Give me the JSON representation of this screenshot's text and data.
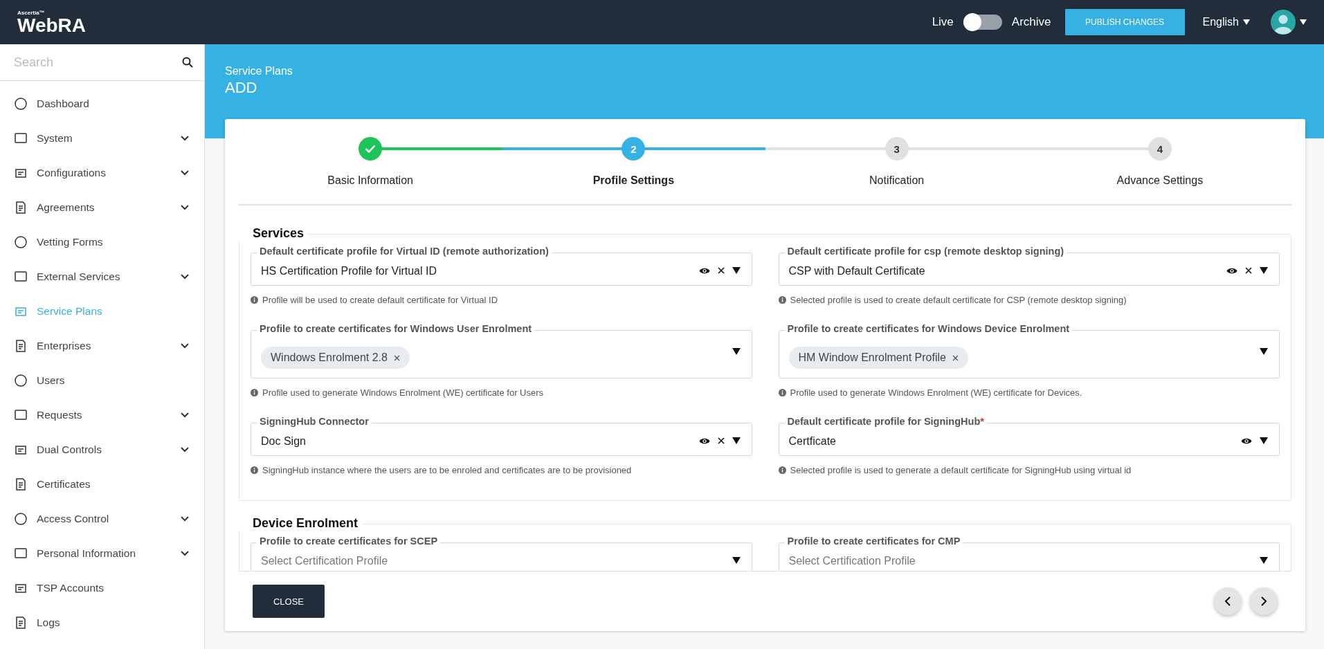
{
  "header": {
    "brand_small": "Ascertia™",
    "brand": "WebRA",
    "toggle": {
      "left_label": "Live",
      "right_label": "Archive",
      "on": false
    },
    "publish_button": "PUBLISH CHANGES",
    "language": "English"
  },
  "sidebar": {
    "search": {
      "placeholder": "Search"
    },
    "items": [
      {
        "label": "Dashboard",
        "expandable": false,
        "selected": false
      },
      {
        "label": "System",
        "expandable": true,
        "selected": false
      },
      {
        "label": "Configurations",
        "expandable": true,
        "selected": false
      },
      {
        "label": "Agreements",
        "expandable": true,
        "selected": false
      },
      {
        "label": "Vetting Forms",
        "expandable": false,
        "selected": false
      },
      {
        "label": "External Services",
        "expandable": true,
        "selected": false
      },
      {
        "label": "Service Plans",
        "expandable": false,
        "selected": true
      },
      {
        "label": "Enterprises",
        "expandable": true,
        "selected": false
      },
      {
        "label": "Users",
        "expandable": false,
        "selected": false
      },
      {
        "label": "Requests",
        "expandable": true,
        "selected": false
      },
      {
        "label": "Dual Controls",
        "expandable": true,
        "selected": false
      },
      {
        "label": "Certificates",
        "expandable": false,
        "selected": false
      },
      {
        "label": "Access Control",
        "expandable": true,
        "selected": false
      },
      {
        "label": "Personal Information",
        "expandable": true,
        "selected": false
      },
      {
        "label": "TSP Accounts",
        "expandable": false,
        "selected": false
      },
      {
        "label": "Logs",
        "expandable": false,
        "selected": false
      }
    ]
  },
  "banner": {
    "breadcrumb": "Service Plans",
    "title": "ADD"
  },
  "stepper": [
    {
      "label": "Basic Information",
      "completed": true,
      "selected": false
    },
    {
      "number": "2",
      "label": "Profile Settings",
      "completed": false,
      "selected": true
    },
    {
      "number": "3",
      "label": "Notification",
      "completed": false,
      "selected": false
    },
    {
      "number": "4",
      "label": "Advance Settings",
      "completed": false,
      "selected": false
    }
  ],
  "sections": [
    {
      "title": "Services",
      "fields": [
        {
          "kind": "select",
          "label": "Default certificate profile for Virtual ID (remote authorization)",
          "value": "HS Certification Profile for Virtual ID",
          "viewable": true,
          "clearable": true,
          "hint": "Profile will be used to create default certificate for Virtual ID"
        },
        {
          "kind": "select",
          "label": "Default certificate profile for csp (remote desktop signing)",
          "value": "CSP with Default Certificate",
          "viewable": true,
          "clearable": true,
          "hint": "Selected profile is used to create default certificate for CSP (remote desktop signing)"
        },
        {
          "kind": "tags",
          "label": "Profile to create certificates for Windows User Enrolment",
          "tags": [
            "Windows Enrolment 2.8"
          ],
          "hint": "Profile used to generate Windows Enrolment (WE) certificate for Users"
        },
        {
          "kind": "tags",
          "label": "Profile to create certificates for Windows Device Enrolment",
          "tags": [
            "HM Window Enrolment Profile"
          ],
          "hint": "Profile used to generate Windows Enrolment (WE) certificate for Devices."
        },
        {
          "kind": "select",
          "label": "SigningHub Connector",
          "value": "Doc Sign",
          "viewable": true,
          "clearable": true,
          "hint": "SigningHub instance where the users are to be enroled and certificates are to be provisioned"
        },
        {
          "kind": "select",
          "label": "Default certificate profile for SigningHub",
          "required_mark": "*",
          "value": "Certficate",
          "viewable": true,
          "clearable": false,
          "hint": "Selected profile is used to generate a default certificate for SigningHub using virtual id"
        }
      ]
    },
    {
      "title": "Device Enrolment",
      "fields": [
        {
          "kind": "select",
          "label": "Profile to create certificates for SCEP",
          "placeholder": "Select Certification Profile",
          "viewable": false,
          "clearable": false
        },
        {
          "kind": "select",
          "label": "Profile to create certificates for CMP",
          "placeholder": "Select Certification Profile",
          "viewable": false,
          "clearable": false
        }
      ]
    }
  ],
  "footer": {
    "close_button": "CLOSE"
  }
}
